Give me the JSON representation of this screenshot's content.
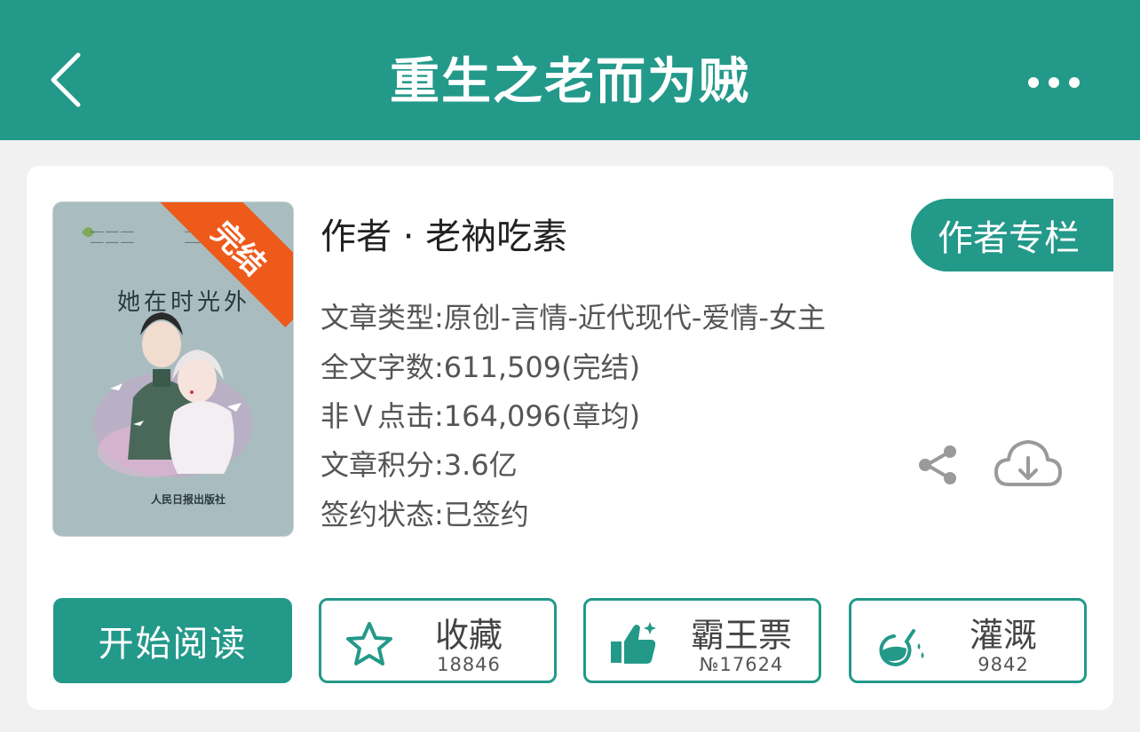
{
  "header": {
    "title": "重生之老而为贼",
    "back_icon": "chevron-left-icon",
    "more_icon": "more-horizontal-icon",
    "color": "#23998a"
  },
  "book": {
    "cover": {
      "title": "她在时光外",
      "badge": "完结",
      "badge_color": "#ee5a1a",
      "publisher": "人民日报出版社"
    },
    "author_line": "作者 · 老衲吃素",
    "author_column_label": "作者专栏",
    "meta": {
      "type": "文章类型:原创-言情-近代现代-爱情-女主",
      "word_count": "全文字数:611,509(完结)",
      "clicks": "非Ｖ点击:164,096(章均)",
      "score": "文章积分:3.6亿",
      "sign_status": "签约状态:已签约"
    }
  },
  "actions": {
    "read_label": "开始阅读",
    "favorite": {
      "label": "收藏",
      "count": "18846",
      "icon": "star-icon"
    },
    "vote": {
      "label": "霸王票",
      "count": "№17624",
      "icon": "thumbs-up-icon"
    },
    "water": {
      "label": "灌溉",
      "count": "9842",
      "icon": "nutrient-flask-icon"
    },
    "share_icon": "share-icon",
    "download_icon": "cloud-download-icon"
  }
}
